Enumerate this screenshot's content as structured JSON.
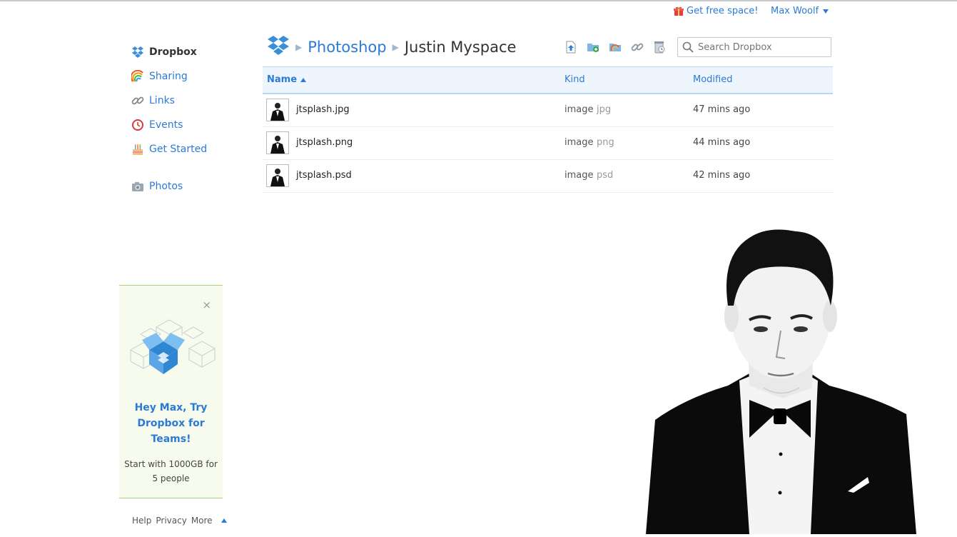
{
  "topbar": {
    "free_space": "Get free space!",
    "user_name": "Max Woolf"
  },
  "sidebar": {
    "items": [
      {
        "label": "Dropbox",
        "icon": "dropbox-icon"
      },
      {
        "label": "Sharing",
        "icon": "rainbow-icon"
      },
      {
        "label": "Links",
        "icon": "chain-link-icon"
      },
      {
        "label": "Events",
        "icon": "clock-icon"
      },
      {
        "label": "Get Started",
        "icon": "cake-icon"
      },
      {
        "label": "Photos",
        "icon": "camera-icon"
      }
    ]
  },
  "breadcrumb": {
    "parent": "Photoshop",
    "current": "Justin Myspace"
  },
  "toolbar": {
    "icons": [
      "upload-icon",
      "new-folder-icon",
      "shared-folder-icon",
      "get-link-icon",
      "deleted-files-icon"
    ]
  },
  "search": {
    "placeholder": "Search Dropbox",
    "value": ""
  },
  "table": {
    "headers": {
      "name": "Name",
      "kind": "Kind",
      "modified": "Modified"
    },
    "rows": [
      {
        "name": "jtsplash.jpg",
        "kind": "image",
        "ext": "jpg",
        "modified": "47 mins ago"
      },
      {
        "name": "jtsplash.png",
        "kind": "image",
        "ext": "png",
        "modified": "44 mins ago"
      },
      {
        "name": "jtsplash.psd",
        "kind": "image",
        "ext": "psd",
        "modified": "42 mins ago"
      }
    ]
  },
  "promo": {
    "close": "×",
    "headline": "Hey Max, Try Dropbox for Teams!",
    "sub": "Start with 1000GB for 5 people"
  },
  "footer": {
    "help": "Help",
    "privacy": "Privacy",
    "more": "More"
  },
  "colors": {
    "link": "#2b7bd6",
    "header_bg": "#eef5fc",
    "promo_bg": "#f7fbee",
    "promo_border": "#a9d27c"
  }
}
